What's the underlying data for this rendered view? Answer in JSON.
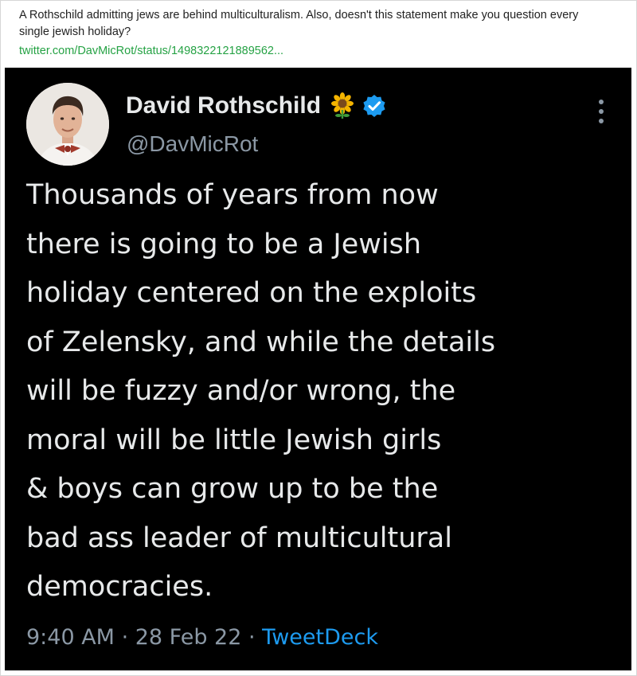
{
  "post": {
    "text": "A Rothschild admitting jews are behind multiculturalism. Also, doesn't this statement make you question every single jewish holiday?",
    "link": "twitter.com/DavMicRot/status/1498322121889562..."
  },
  "tweet": {
    "display_name": "David Rothschild",
    "handle": "@DavMicRot",
    "badges": [
      "sunflower-icon",
      "verified-icon"
    ],
    "body_lines": [
      "Thousands of years from now",
      "there is going to be a Jewish",
      "holiday centered on the exploits",
      "of Zelensky, and while the details",
      "will be fuzzy and/or wrong, the",
      "moral will be little Jewish girls",
      "& boys can grow up to be the",
      "bad ass leader of multicultural",
      "democracies."
    ],
    "time": "9:40 AM",
    "separator_1": " · ",
    "date": "28 Feb 22",
    "separator_2": " · ",
    "source": "TweetDeck"
  },
  "colors": {
    "link_green": "#25a244",
    "tweet_background": "#000000",
    "verified_blue": "#1d9bf0",
    "muted_gray": "#8b98a5"
  }
}
